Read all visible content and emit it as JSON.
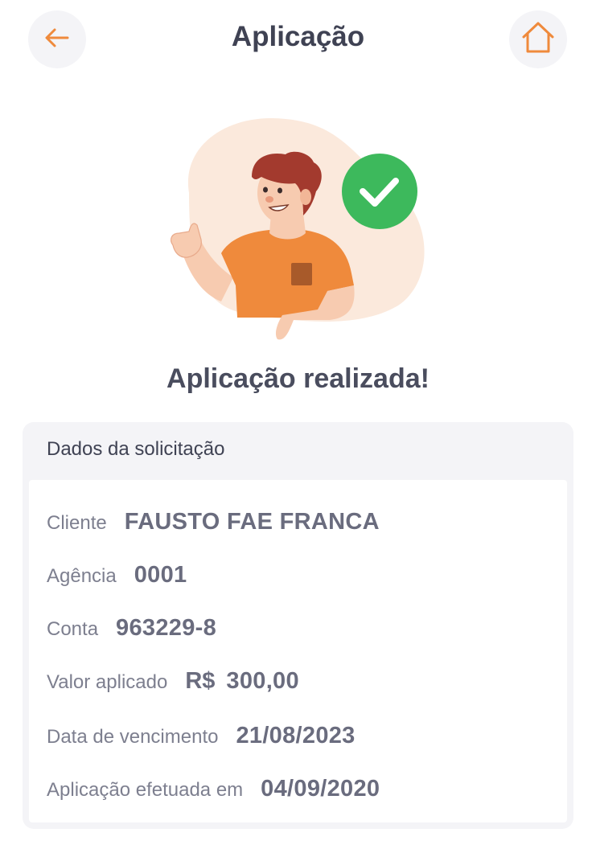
{
  "header": {
    "title": "Aplicação",
    "back_icon": "arrow-left-icon",
    "home_icon": "home-icon"
  },
  "colors": {
    "accent": "#ef8a3c",
    "success": "#3db95c",
    "button_bg": "#f4f4f7",
    "card_bg": "#f4f4f7",
    "blob": "#fbe9dc"
  },
  "success_message": "Aplicação realizada!",
  "card": {
    "title": "Dados da solicitação",
    "rows": [
      {
        "label": "Cliente",
        "value": "FAUSTO FAE FRANCA"
      },
      {
        "label": "Agência",
        "value": "0001"
      },
      {
        "label": "Conta",
        "value": "963229-8"
      },
      {
        "label": "Valor aplicado",
        "currency": "R$",
        "value": "300,00"
      },
      {
        "label": "Data de vencimento",
        "value": "21/08/2023"
      },
      {
        "label": "Aplicação efetuada em",
        "value": "04/09/2020"
      }
    ]
  }
}
